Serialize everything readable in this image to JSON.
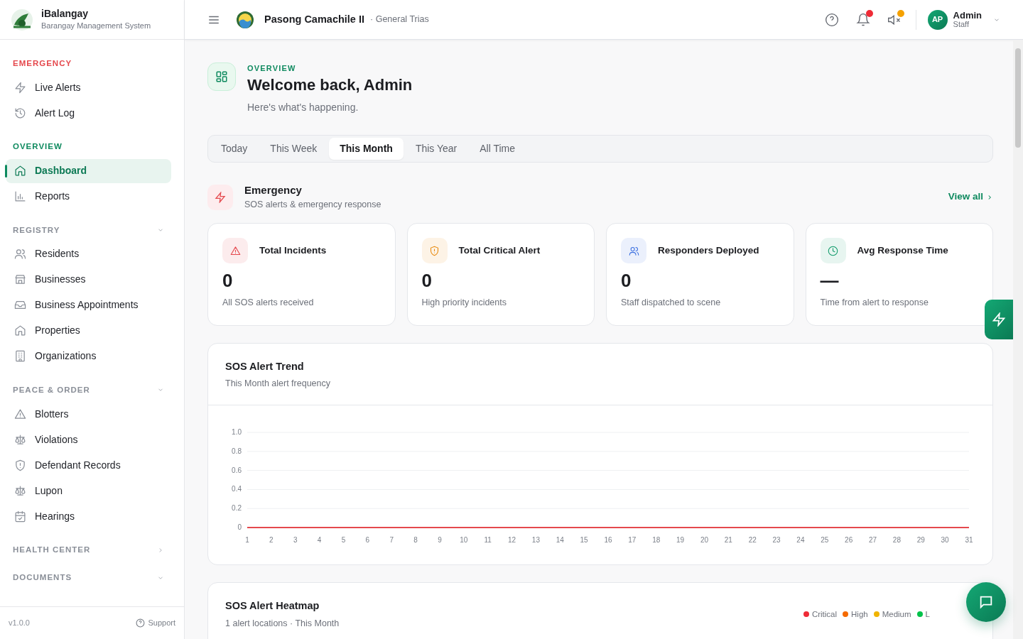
{
  "brand": {
    "name": "iBalangay",
    "subtitle": "Barangay Management System"
  },
  "sidebar": {
    "sections": [
      {
        "title": "EMERGENCY",
        "kind": "fixed",
        "color": "#e5484d",
        "items": [
          {
            "label": "Live Alerts",
            "selected": false
          },
          {
            "label": "Alert Log",
            "selected": false
          }
        ]
      },
      {
        "title": "OVERVIEW",
        "kind": "fixed",
        "color": "#0f8a5f",
        "items": [
          {
            "label": "Dashboard",
            "selected": true
          },
          {
            "label": "Reports",
            "selected": false
          }
        ]
      },
      {
        "title": "REGISTRY",
        "kind": "collapsible",
        "color": "#8a8f98",
        "expanded": true,
        "items": [
          {
            "label": "Residents",
            "selected": false
          },
          {
            "label": "Businesses",
            "selected": false
          },
          {
            "label": "Business Appointments",
            "selected": false
          },
          {
            "label": "Properties",
            "selected": false
          },
          {
            "label": "Organizations",
            "selected": false
          }
        ]
      },
      {
        "title": "PEACE & ORDER",
        "kind": "collapsible",
        "color": "#8a8f98",
        "expanded": true,
        "items": [
          {
            "label": "Blotters",
            "selected": false
          },
          {
            "label": "Violations",
            "selected": false
          },
          {
            "label": "Defendant Records",
            "selected": false
          },
          {
            "label": "Lupon",
            "selected": false
          },
          {
            "label": "Hearings",
            "selected": false
          }
        ]
      },
      {
        "title": "HEALTH CENTER",
        "kind": "collapsible",
        "color": "#8a8f98",
        "expanded": false
      },
      {
        "title": "DOCUMENTS",
        "kind": "collapsible",
        "color": "#8a8f98",
        "expanded": true
      }
    ],
    "version": "v1.0.0",
    "support": "Support"
  },
  "topbar": {
    "barangay": "Pasong Camachile II",
    "city": "· General Trias",
    "user": {
      "initials": "AP",
      "name": "Admin",
      "role": "Staff"
    }
  },
  "header": {
    "eyebrow": "OVERVIEW",
    "title": "Welcome back, Admin",
    "subtitle": "Here's what's happening."
  },
  "period_tabs": [
    {
      "label": "Today",
      "selected": false
    },
    {
      "label": "This Week",
      "selected": false
    },
    {
      "label": "This Month",
      "selected": true
    },
    {
      "label": "This Year",
      "selected": false
    },
    {
      "label": "All Time",
      "selected": false
    }
  ],
  "emergency": {
    "title": "Emergency",
    "subtitle": "SOS alerts & emergency response",
    "link": "View all"
  },
  "stats": [
    {
      "title": "Total Incidents",
      "value": "0",
      "caption": "All SOS alerts received",
      "color": "#e5484d"
    },
    {
      "title": "Total Critical Alert",
      "value": "0",
      "caption": "High priority incidents",
      "color": "#e8890c"
    },
    {
      "title": "Responders Deployed",
      "value": "0",
      "caption": "Staff dispatched to scene",
      "color": "#3b6fe0"
    },
    {
      "title": "Avg Response Time",
      "value": "—",
      "caption": "Time from alert to response",
      "color": "#0f9a6a"
    }
  ],
  "trend": {
    "title": "SOS Alert Trend",
    "subtitle": "This Month alert frequency",
    "chart_data": {
      "type": "line",
      "grid": true,
      "x": [
        1,
        2,
        3,
        4,
        5,
        6,
        7,
        8,
        9,
        10,
        11,
        12,
        13,
        14,
        15,
        16,
        17,
        18,
        19,
        20,
        21,
        22,
        23,
        24,
        25,
        26,
        27,
        28,
        29,
        30,
        31
      ],
      "series": [
        {
          "color": "#e5484d",
          "values": [
            0,
            0,
            0,
            0,
            0,
            0,
            0,
            0,
            0,
            0,
            0,
            0,
            0,
            0,
            0,
            0,
            0,
            0,
            0,
            0,
            0,
            0,
            0,
            0,
            0,
            0,
            0,
            0,
            0,
            0,
            0
          ]
        }
      ],
      "ylim": [
        0,
        1
      ],
      "yticks": [
        {
          "value": 0,
          "label": "0"
        },
        {
          "value": 0.2,
          "label": "0.2"
        },
        {
          "value": 0.4,
          "label": "0.4"
        },
        {
          "value": 0.6,
          "label": "0.6"
        },
        {
          "value": 0.8,
          "label": "0.8"
        },
        {
          "value": 1,
          "label": "1.0"
        }
      ]
    }
  },
  "heatmap": {
    "title": "SOS Alert Heatmap",
    "subtitle": "1 alert locations · This Month",
    "legend": [
      {
        "label": "Critical",
        "color": "#ef2b36"
      },
      {
        "label": "High",
        "color": "#f56a00"
      },
      {
        "label": "Medium",
        "color": "#f0b400"
      },
      {
        "label": "L",
        "color": "#00c24a"
      }
    ]
  }
}
